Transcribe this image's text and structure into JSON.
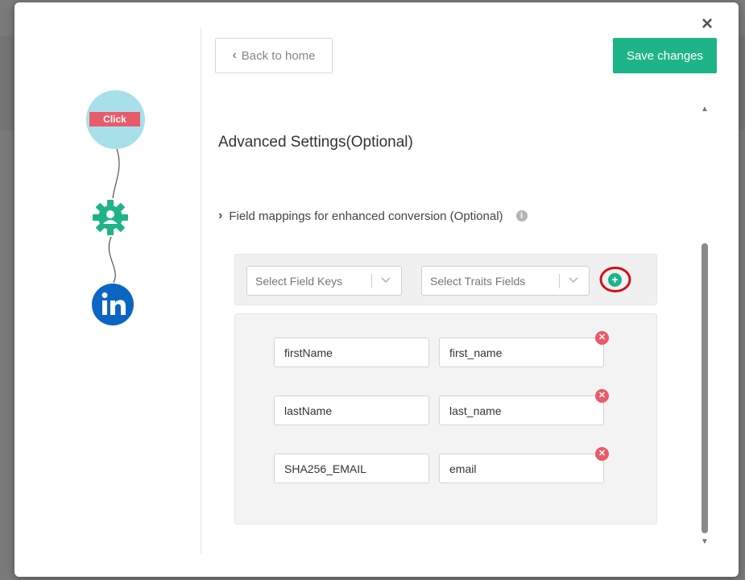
{
  "modal": {
    "close_label": "×"
  },
  "flow": {
    "nodes": [
      {
        "name": "click",
        "label": "Click"
      },
      {
        "name": "gear-user",
        "label": ""
      },
      {
        "name": "linkedin",
        "label": "in"
      }
    ],
    "colors": {
      "click_bg": "#a8e0e9",
      "click_label_bg": "#e85b6a",
      "gear": "#1fb38a",
      "linkedin": "#0a66c2"
    }
  },
  "toolbar": {
    "back_label": "Back to home",
    "save_label": "Save changes",
    "save_color": "#1fb38a"
  },
  "settings": {
    "title": "Advanced Settings(Optional)",
    "section_label": "Field mappings for enhanced conversion (Optional)"
  },
  "selects": {
    "field_keys_placeholder": "Select Field Keys",
    "traits_placeholder": "Select Traits Fields"
  },
  "mappings": [
    {
      "key": "firstName",
      "trait": "first_name"
    },
    {
      "key": "lastName",
      "trait": "last_name"
    },
    {
      "key": "SHA256_EMAIL",
      "trait": "email"
    }
  ]
}
